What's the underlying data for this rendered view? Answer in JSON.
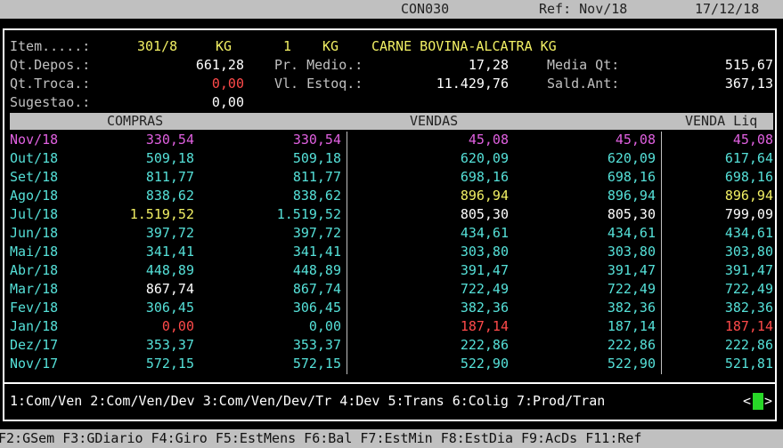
{
  "screen": {
    "program": "CON030",
    "ref_label": "Ref: Nov/18",
    "date": "17/12/18"
  },
  "colors": {
    "white": "#ffffff",
    "cyan": "#55e0d8",
    "yellow": "#f2f064",
    "magenta": "#e060e0",
    "red": "#ff4a4a",
    "green": "#28d828",
    "grey": "#c0c0c0",
    "bar_text": "#222222"
  },
  "item": {
    "label": "Item.....:",
    "code": "301/8",
    "unit1": "KG",
    "qty": "1",
    "unit2": "KG",
    "desc": "CARNE BOVINA-ALCATRA KG"
  },
  "fields": {
    "qt_depos_label": "Qt.Depos.:",
    "qt_depos": "661,28",
    "pr_medio_label": "Pr. Medio.:",
    "pr_medio": "17,28",
    "media_qt_label": "Media Qt:",
    "media_qt": "515,67",
    "qt_troca_label": "Qt.Troca.:",
    "qt_troca": "0,00",
    "vl_estoq_label": "Vl. Estoq.:",
    "vl_estoq": "11.429,76",
    "sald_ant_label": "Sald.Ant:",
    "sald_ant": "367,13",
    "sugestao_label": "Sugestao.:",
    "sugestao": "0,00"
  },
  "table": {
    "headers": [
      "COMPRAS",
      "VENDAS",
      "VENDA Liq"
    ],
    "rows": [
      {
        "month": "Nov/18",
        "v1": "330,54",
        "v2": "330,54",
        "v3": "45,08",
        "v4": "45,08",
        "v5": "45,08",
        "colors": [
          "magenta",
          "magenta",
          "magenta",
          "magenta",
          "magenta",
          "magenta"
        ]
      },
      {
        "month": "Out/18",
        "v1": "509,18",
        "v2": "509,18",
        "v3": "620,09",
        "v4": "620,09",
        "v5": "617,64",
        "colors": [
          "cyan",
          "cyan",
          "cyan",
          "cyan",
          "cyan",
          "cyan"
        ]
      },
      {
        "month": "Set/18",
        "v1": "811,77",
        "v2": "811,77",
        "v3": "698,16",
        "v4": "698,16",
        "v5": "698,16",
        "colors": [
          "cyan",
          "cyan",
          "cyan",
          "cyan",
          "cyan",
          "cyan"
        ]
      },
      {
        "month": "Ago/18",
        "v1": "838,62",
        "v2": "838,62",
        "v3": "896,94",
        "v4": "896,94",
        "v5": "896,94",
        "colors": [
          "cyan",
          "cyan",
          "cyan",
          "yellow",
          "cyan",
          "yellow"
        ]
      },
      {
        "month": "Jul/18",
        "v1": "1.519,52",
        "v2": "1.519,52",
        "v3": "805,30",
        "v4": "805,30",
        "v5": "799,09",
        "colors": [
          "cyan",
          "yellow",
          "cyan",
          "white",
          "white",
          "white"
        ]
      },
      {
        "month": "Jun/18",
        "v1": "397,72",
        "v2": "397,72",
        "v3": "434,61",
        "v4": "434,61",
        "v5": "434,61",
        "colors": [
          "cyan",
          "cyan",
          "cyan",
          "cyan",
          "cyan",
          "cyan"
        ]
      },
      {
        "month": "Mai/18",
        "v1": "341,41",
        "v2": "341,41",
        "v3": "303,80",
        "v4": "303,80",
        "v5": "303,80",
        "colors": [
          "cyan",
          "cyan",
          "cyan",
          "cyan",
          "cyan",
          "cyan"
        ]
      },
      {
        "month": "Abr/18",
        "v1": "448,89",
        "v2": "448,89",
        "v3": "391,47",
        "v4": "391,47",
        "v5": "391,47",
        "colors": [
          "cyan",
          "cyan",
          "cyan",
          "cyan",
          "cyan",
          "cyan"
        ]
      },
      {
        "month": "Mar/18",
        "v1": "867,74",
        "v2": "867,74",
        "v3": "722,49",
        "v4": "722,49",
        "v5": "722,49",
        "colors": [
          "cyan",
          "white",
          "cyan",
          "cyan",
          "cyan",
          "cyan"
        ]
      },
      {
        "month": "Fev/18",
        "v1": "306,45",
        "v2": "306,45",
        "v3": "382,36",
        "v4": "382,36",
        "v5": "382,36",
        "colors": [
          "cyan",
          "cyan",
          "cyan",
          "cyan",
          "cyan",
          "cyan"
        ]
      },
      {
        "month": "Jan/18",
        "v1": "0,00",
        "v2": "0,00",
        "v3": "187,14",
        "v4": "187,14",
        "v5": "187,14",
        "colors": [
          "cyan",
          "red",
          "cyan",
          "red",
          "cyan",
          "red"
        ]
      },
      {
        "month": "Dez/17",
        "v1": "353,37",
        "v2": "353,37",
        "v3": "222,86",
        "v4": "222,86",
        "v5": "222,86",
        "colors": [
          "cyan",
          "cyan",
          "cyan",
          "cyan",
          "cyan",
          "cyan"
        ]
      },
      {
        "month": "Nov/17",
        "v1": "572,15",
        "v2": "572,15",
        "v3": "522,90",
        "v4": "522,90",
        "v5": "521,81",
        "colors": [
          "cyan",
          "cyan",
          "cyan",
          "cyan",
          "cyan",
          "cyan"
        ]
      }
    ]
  },
  "options_line": "1:Com/Ven 2:Com/Ven/Dev 3:Com/Ven/Dev/Tr 4:Dev 5:Trans 6:Colig 7:Prod/Tran",
  "options_arrow_left": "<",
  "options_arrow_right": ">",
  "function_keys": "F2:GSem F3:GDiario F4:Giro F5:EstMens F6:Bal F7:EstMin F8:EstDia F9:AcDs F11:Ref"
}
